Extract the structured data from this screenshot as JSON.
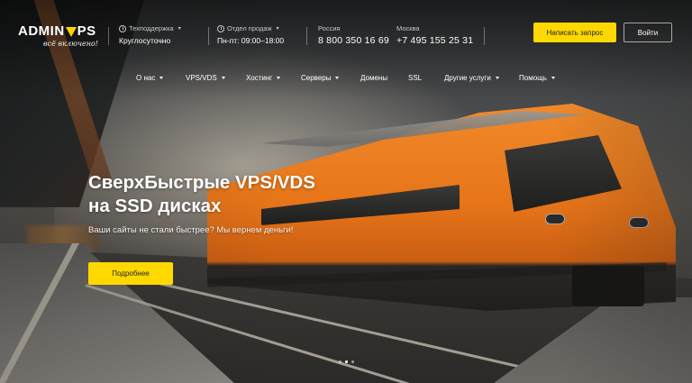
{
  "logo": {
    "text_before": "ADMIN",
    "text_after": "PS",
    "tagline": "всё включено!"
  },
  "header": {
    "support": {
      "label": "Техподдержка",
      "value": "Круглосуточно"
    },
    "sales": {
      "label": "Отдел продаж",
      "value": "Пн-пт: 09:00–18:00"
    },
    "russia": {
      "label": "Россия",
      "phone": "8 800 350 16 69"
    },
    "moscow": {
      "label": "Москва",
      "phone": "+7 495 155 25 31"
    },
    "request_button": "Написать запрос",
    "login_button": "Войти"
  },
  "nav": {
    "items": [
      {
        "label": "О нас",
        "has_dropdown": true
      },
      {
        "label": "VPS/VDS",
        "has_dropdown": true
      },
      {
        "label": "Хостинг",
        "has_dropdown": true
      },
      {
        "label": "Серверы",
        "has_dropdown": true
      },
      {
        "label": "Домены",
        "has_dropdown": false
      },
      {
        "label": "SSL",
        "has_dropdown": false
      },
      {
        "label": "Другие услуги",
        "has_dropdown": true
      },
      {
        "label": "Помощь",
        "has_dropdown": true
      }
    ]
  },
  "hero": {
    "title_line1": "СверхБыстрые VPS/VDS",
    "title_line2": "на SSD дисках",
    "subtitle": "Ваши сайты не стали быстрее? Мы вернем деньги!",
    "button": "Подробнее"
  },
  "slider": {
    "dots": 3,
    "active_index": 1
  },
  "colors": {
    "accent": "#ffd800",
    "train": "#e77418"
  }
}
